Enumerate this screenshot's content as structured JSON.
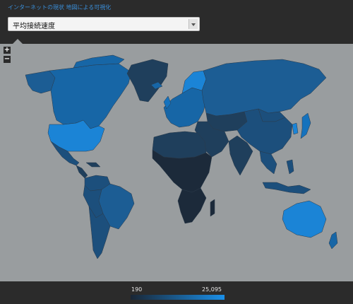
{
  "app": {
    "title": "インターネットの現状 地図による可視化"
  },
  "metric_select": {
    "selected": "平均接続速度"
  },
  "map": {
    "zoom_in_label": "+",
    "zoom_out_label": "−",
    "colors": {
      "ocean": "#999d9f",
      "lowest": "#1c2a3a",
      "low": "#1f3f5c",
      "mid_low": "#1c4f7c",
      "mid": "#1c5d94",
      "mid_high": "#1766a6",
      "high": "#1572bd",
      "highest": "#1b84d6"
    }
  },
  "legend": {
    "min_label": "190",
    "max_label": "25,095",
    "gradient_start": "#1a2635",
    "gradient_end": "#1a8fe8"
  }
}
